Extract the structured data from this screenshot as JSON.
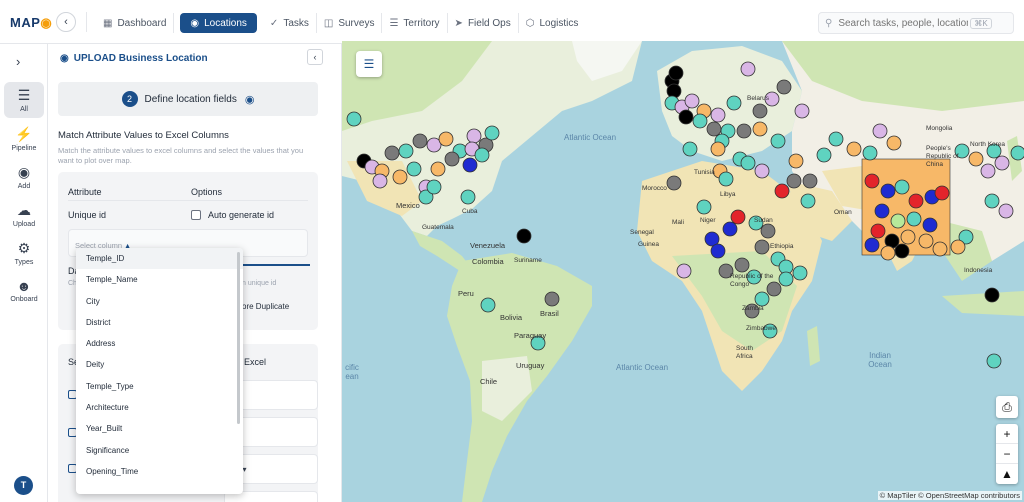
{
  "app": {
    "logo_text": "MAP",
    "logo_accent": "$"
  },
  "nav": {
    "back_icon": "chevron-left-icon",
    "items": [
      {
        "label": "Dashboard",
        "icon": "dashboard-icon"
      },
      {
        "label": "Locations",
        "icon": "location-pin-icon",
        "active": true
      },
      {
        "label": "Tasks",
        "icon": "checkmark-icon"
      },
      {
        "label": "Surveys",
        "icon": "clipboard-icon"
      },
      {
        "label": "Territory",
        "icon": "map-icon"
      },
      {
        "label": "Field Ops",
        "icon": "send-icon"
      },
      {
        "label": "Logistics",
        "icon": "box-icon"
      }
    ]
  },
  "search": {
    "placeholder": "Search tasks, people, locations...",
    "shortcut": "⌘K"
  },
  "rail": {
    "items": [
      {
        "label": "All"
      },
      {
        "label": "Pipeline"
      },
      {
        "label": "Add"
      },
      {
        "label": "Upload"
      },
      {
        "label": "Types"
      },
      {
        "label": "Onboard"
      }
    ],
    "avatar_initial": "T"
  },
  "panel": {
    "title": "UPLOAD Business Location",
    "step_number": "2",
    "step_label": "Define location fields",
    "section_title": "Match Attribute Values to Excel Columns",
    "section_subtitle": "Match the attribute values to excel columns and select the values that you want to plot over map.",
    "table_header_attribute": "Attribute",
    "table_header_options": "Options",
    "row_unique_id": "Unique id",
    "auto_generate_label": "Auto generate id",
    "select_placeholder": "Select column",
    "partial_da": "Da",
    "partial_ch": "Ch",
    "partial_unique_hint": "n unique id",
    "partial_duplicate": "ore Duplicate",
    "partial_se": "Se",
    "partial_excel": "Excel",
    "partial_caret_text": "t"
  },
  "dropdown": {
    "options": [
      "Temple_ID",
      "Temple_Name",
      "City",
      "District",
      "Address",
      "Deity",
      "Temple_Type",
      "Architecture",
      "Year_Built",
      "Significance",
      "Opening_Time"
    ],
    "hover_index": 0
  },
  "map": {
    "attribution": "© MapTiler © OpenStreetMap contributors",
    "colors": {
      "land": "#f2efe6",
      "water": "#a9d3df",
      "desert": "#f1e4b5",
      "forest": "#cfe5b3",
      "teal": "#5fd3c0",
      "grey": "#7a7a7a",
      "orange": "#f7b868",
      "pink": "#d9b6e6",
      "blue": "#1f2bd1",
      "red": "#e3242b",
      "black": "#000000",
      "lightgreen": "#b6e89a"
    },
    "labels": {
      "canada_region": "",
      "mexico": "Mexico",
      "cuba": "Cuba",
      "guatemala": "Guatemala",
      "venezuela": "Venezuela",
      "colombia": "Colombia",
      "suriname": "Suriname",
      "peru": "Peru",
      "bolivia": "Bolivia",
      "brasil": "Brasil",
      "paraguay": "Paraguay",
      "uruguay": "Uruguay",
      "chile": "Chile",
      "atlantic_ocean_n": "Atlantic Ocean",
      "atlantic_ocean_s": "Atlantic Ocean",
      "pacific_partial": "cific ean",
      "indian_ocean": "Indian Ocean",
      "belarus": "Belarus",
      "mongolia": "Mongolia",
      "china": "People's Republic of China",
      "morocco": "Morocco",
      "libya": "Libya",
      "tunisia": "Tunisia",
      "mali": "Mali",
      "niger": "Niger",
      "sudan": "Sudan",
      "senegal": "Senegal",
      "guinea": "Guinea",
      "ethiopia": "Ethiopia",
      "oman": "Oman",
      "drc": "Republic of the Congo",
      "zambia": "Zambia",
      "zimbabwe": "Zimbabwe",
      "south_africa": "South Africa",
      "indonesia": "Indonesia",
      "north_korea": "North Korea"
    }
  }
}
